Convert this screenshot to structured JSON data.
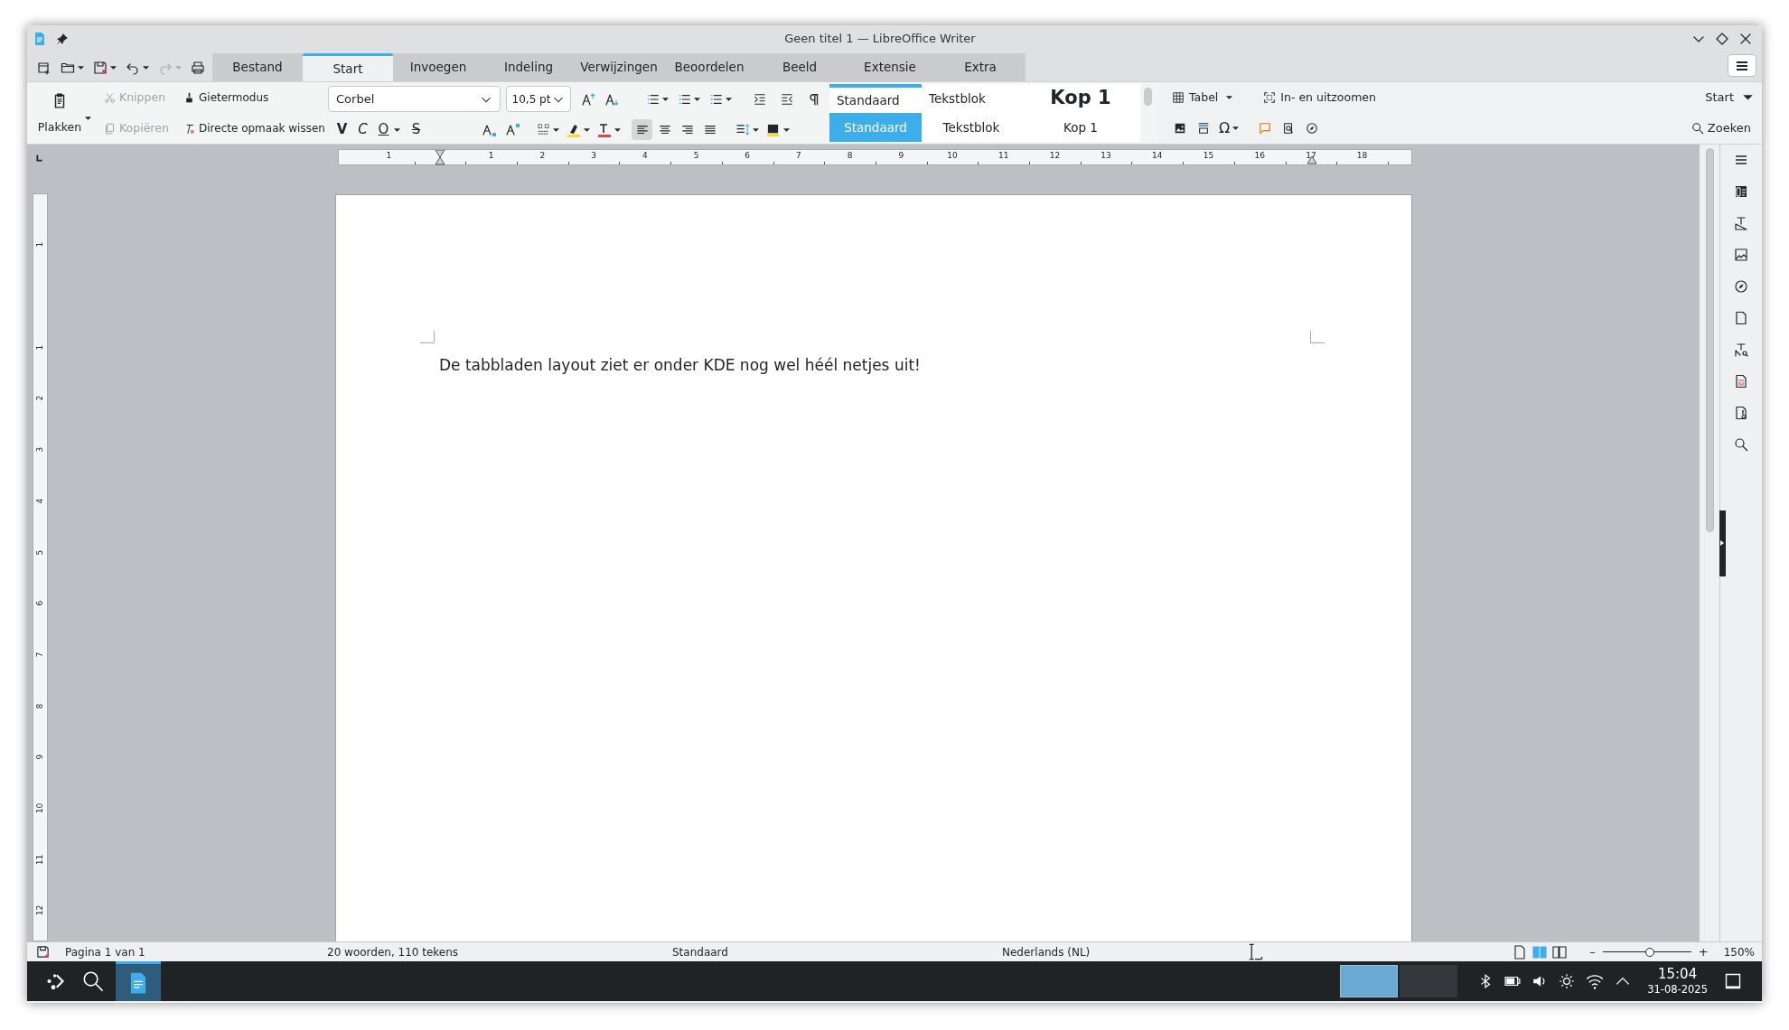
{
  "window": {
    "title": "Geen titel 1 — LibreOffice Writer"
  },
  "quick_toolbar": [
    {
      "kind": "new",
      "dropdown": false,
      "disabled": false
    },
    {
      "kind": "open",
      "dropdown": true,
      "disabled": false
    },
    {
      "kind": "save",
      "dropdown": true,
      "disabled": false
    },
    {
      "kind": "undo",
      "dropdown": true,
      "disabled": false
    },
    {
      "kind": "redo",
      "dropdown": true,
      "disabled": true
    },
    {
      "kind": "print",
      "dropdown": false,
      "disabled": false
    }
  ],
  "tabs": [
    {
      "label": "Bestand",
      "selected": false
    },
    {
      "label": "Start",
      "selected": true
    },
    {
      "label": "Invoegen",
      "selected": false
    },
    {
      "label": "Indeling",
      "selected": false
    },
    {
      "label": "Verwijzingen",
      "selected": false
    },
    {
      "label": "Beoordelen",
      "selected": false
    },
    {
      "label": "Beeld",
      "selected": false
    },
    {
      "label": "Extensie",
      "selected": false
    },
    {
      "label": "Extra",
      "selected": false
    }
  ],
  "ribbon": {
    "paste": "Plakken",
    "clipboard": [
      {
        "kind": "cut",
        "label": "Knippen",
        "disabled": true
      },
      {
        "kind": "copy",
        "label": "Kopiëren",
        "disabled": true
      }
    ],
    "format_tools": [
      {
        "kind": "brush",
        "label": "Gietermodus"
      },
      {
        "kind": "clear",
        "label": "Directe opmaak wissen"
      }
    ],
    "font_name": "Corbel",
    "font_size": "10,5 pt",
    "text_styles": [
      {
        "kind": "bold",
        "label": "V"
      },
      {
        "kind": "italic",
        "label": "C"
      },
      {
        "kind": "underline",
        "label": "O"
      },
      {
        "kind": "strike",
        "label": "S"
      }
    ],
    "alignment": [
      {
        "kind": "left",
        "selected": true
      },
      {
        "kind": "center",
        "selected": false
      },
      {
        "kind": "right",
        "selected": false
      },
      {
        "kind": "justify",
        "selected": false
      }
    ],
    "styles": [
      {
        "kind": "body",
        "preview": "Standaard",
        "name": "Standaard",
        "selected": true
      },
      {
        "kind": "body",
        "preview": "Tekstblok",
        "name": "Tekstblok",
        "selected": false
      },
      {
        "kind": "heading",
        "preview": "Kop 1",
        "name": "Kop 1",
        "selected": false
      }
    ],
    "special_character": "Ω",
    "table": "Tabel",
    "zoom": "In- en uitzoomen",
    "tab_menu": "Start",
    "search": "Zoeken"
  },
  "ruler": {
    "horizontal": [
      "1",
      "1",
      "2",
      "3",
      "4",
      "5",
      "6",
      "7",
      "8",
      "9",
      "10",
      "11",
      "12",
      "13",
      "14",
      "15",
      "16",
      "17",
      "18"
    ],
    "vertical": [
      "1",
      "1",
      "2",
      "3",
      "4",
      "5",
      "6",
      "7",
      "8",
      "9",
      "10",
      "11",
      "12"
    ]
  },
  "document": {
    "text": "De tabbladen layout ziet er onder KDE nog wel héél netjes uit!"
  },
  "status_bar": {
    "page": "Pagina 1 van 1",
    "words": "20 woorden, 110 tekens",
    "page_style": "Standaard",
    "language": "Nederlands (NL)",
    "view_modes": [
      {
        "kind": "single",
        "selected": false
      },
      {
        "kind": "multi",
        "selected": true
      },
      {
        "kind": "book",
        "selected": false
      }
    ],
    "zoom_out": "–",
    "zoom_in": "+",
    "zoom": {
      "level": 0.53
    },
    "zoom_label": "150%"
  },
  "taskbar": {
    "time": "15:04",
    "date": "31-08-2025",
    "desktops": [
      {
        "selected": true
      },
      {
        "selected": false
      }
    ]
  }
}
